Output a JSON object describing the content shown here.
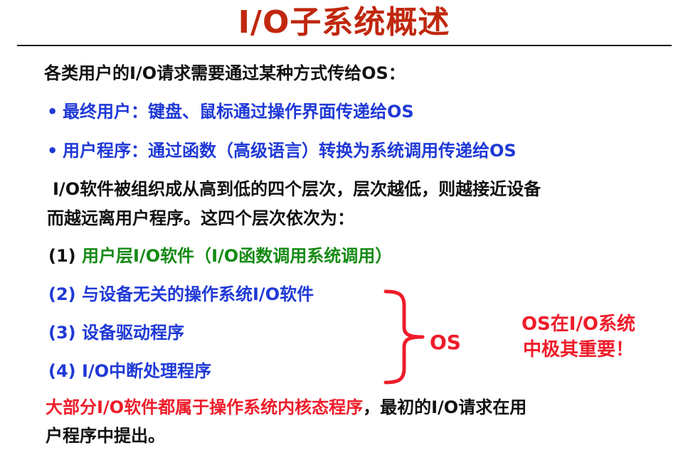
{
  "slide": {
    "title": "I/O子系统概述",
    "intro": "各类用户的I/O请求需要通过某种方式传给OS：",
    "bullets": [
      {
        "symbol": "•",
        "text": "最终用户：键盘、鼠标通过操作界面传递给OS"
      },
      {
        "symbol": "•",
        "text": "用户程序：通过函数（高级语言）转换为系统调用传递给OS"
      }
    ],
    "paragraph_line1": "I/O软件被组织成从高到低的四个层次，层次越低，则越接近设备",
    "paragraph_line2": "而越远离用户程序。这四个层次依次为：",
    "layers": [
      {
        "num": "(1)",
        "text": "用户层I/O软件（I/O函数调用系统调用）"
      },
      {
        "num": "(2)",
        "text": "与设备无关的操作系统I/O软件"
      },
      {
        "num": "(3)",
        "text": "设备驱动程序"
      },
      {
        "num": "(4)",
        "text": "I/O中断处理程序"
      }
    ],
    "brace_label": "OS",
    "note_line1": "OS在I/O系统",
    "note_line2": "中极其重要！",
    "conclusion_red": "大部分I/O软件都属于操作系统内核态程序",
    "conclusion_rest_line1": "，最初的I/O请求在用",
    "conclusion_line2": "户程序中提出。"
  },
  "colors": {
    "title": "#c0280f",
    "blue": "#1f39d6",
    "green": "#148a14",
    "red": "#ee1c2a",
    "text": "#111111"
  }
}
